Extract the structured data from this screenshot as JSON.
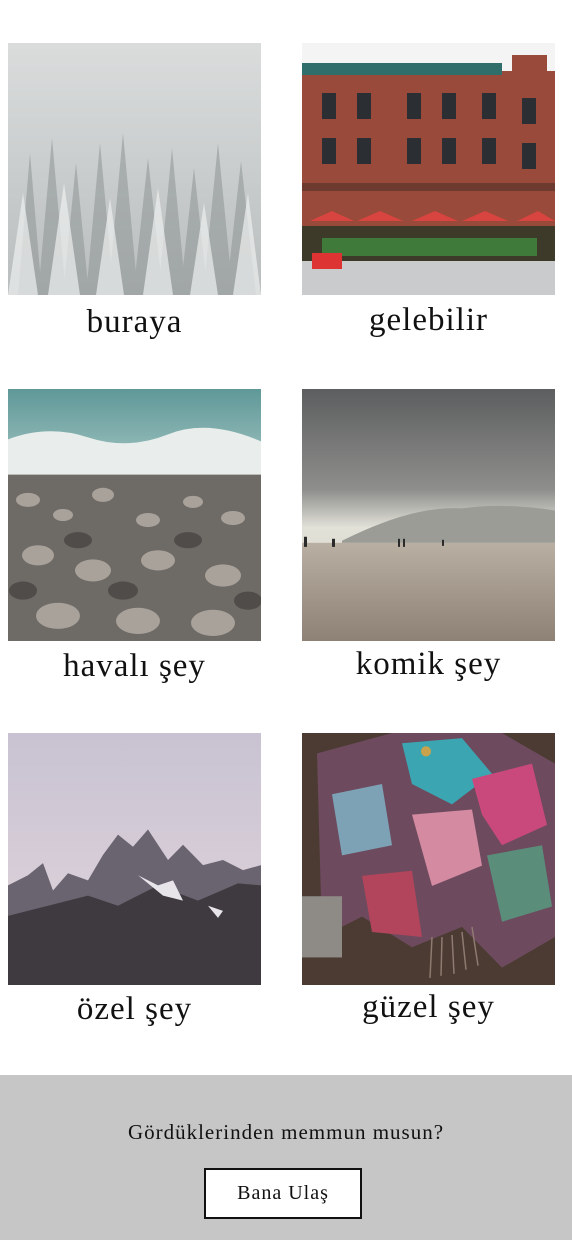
{
  "gallery": {
    "items": [
      {
        "label": "buraya",
        "image": "snowy-forest"
      },
      {
        "label": "gelebilir",
        "image": "brick-building-cafe"
      },
      {
        "label": "havalı şey",
        "image": "pebble-beach"
      },
      {
        "label": "komik şey",
        "image": "cloudy-shore"
      },
      {
        "label": "özel şey",
        "image": "mountain-peaks"
      },
      {
        "label": "güzel şey",
        "image": "patterned-poncho"
      }
    ]
  },
  "footer": {
    "prompt": "Gördüklerinden memmun musun?",
    "button_label": "Bana Ulaş",
    "background": "#c6c6c6"
  }
}
